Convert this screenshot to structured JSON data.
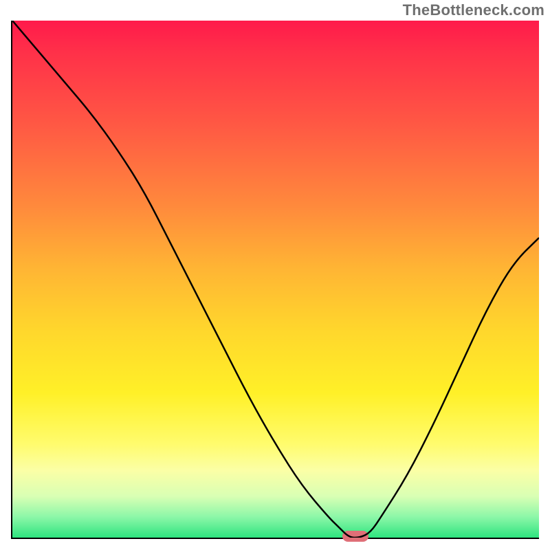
{
  "watermark": "TheBottleneck.com",
  "colors": {
    "curve": "#000000",
    "marker": "#df6f78",
    "axis": "#000000"
  },
  "chart_data": {
    "type": "line",
    "title": "",
    "xlabel": "",
    "ylabel": "",
    "xlim": [
      0,
      100
    ],
    "ylim": [
      0,
      100
    ],
    "grid": false,
    "legend": false,
    "series": [
      {
        "name": "bottleneck-curve",
        "x": [
          0,
          5,
          10,
          15,
          20,
          25,
          30,
          35,
          40,
          45,
          50,
          55,
          60,
          62,
          64,
          66,
          68,
          70,
          75,
          80,
          85,
          90,
          95,
          100
        ],
        "y": [
          100,
          94,
          88,
          82,
          75,
          67,
          57,
          47,
          37,
          27,
          18,
          10,
          4,
          2,
          0,
          0,
          1,
          4,
          12,
          22,
          33,
          44,
          53,
          58
        ]
      }
    ],
    "marker": {
      "x": 65,
      "y": 0,
      "width_pct": 5,
      "height_pct": 2
    },
    "background_gradient": {
      "type": "vertical",
      "stops": [
        {
          "pos": 0,
          "color": "#ff1a4b"
        },
        {
          "pos": 6,
          "color": "#ff3049"
        },
        {
          "pos": 20,
          "color": "#ff5844"
        },
        {
          "pos": 36,
          "color": "#ff8a3c"
        },
        {
          "pos": 48,
          "color": "#ffb534"
        },
        {
          "pos": 60,
          "color": "#ffd72c"
        },
        {
          "pos": 72,
          "color": "#fff028"
        },
        {
          "pos": 82,
          "color": "#fffc6e"
        },
        {
          "pos": 87,
          "color": "#fbffa6"
        },
        {
          "pos": 92,
          "color": "#d9ffb4"
        },
        {
          "pos": 96,
          "color": "#8cf7a8"
        },
        {
          "pos": 100,
          "color": "#2ee47f"
        }
      ]
    }
  }
}
